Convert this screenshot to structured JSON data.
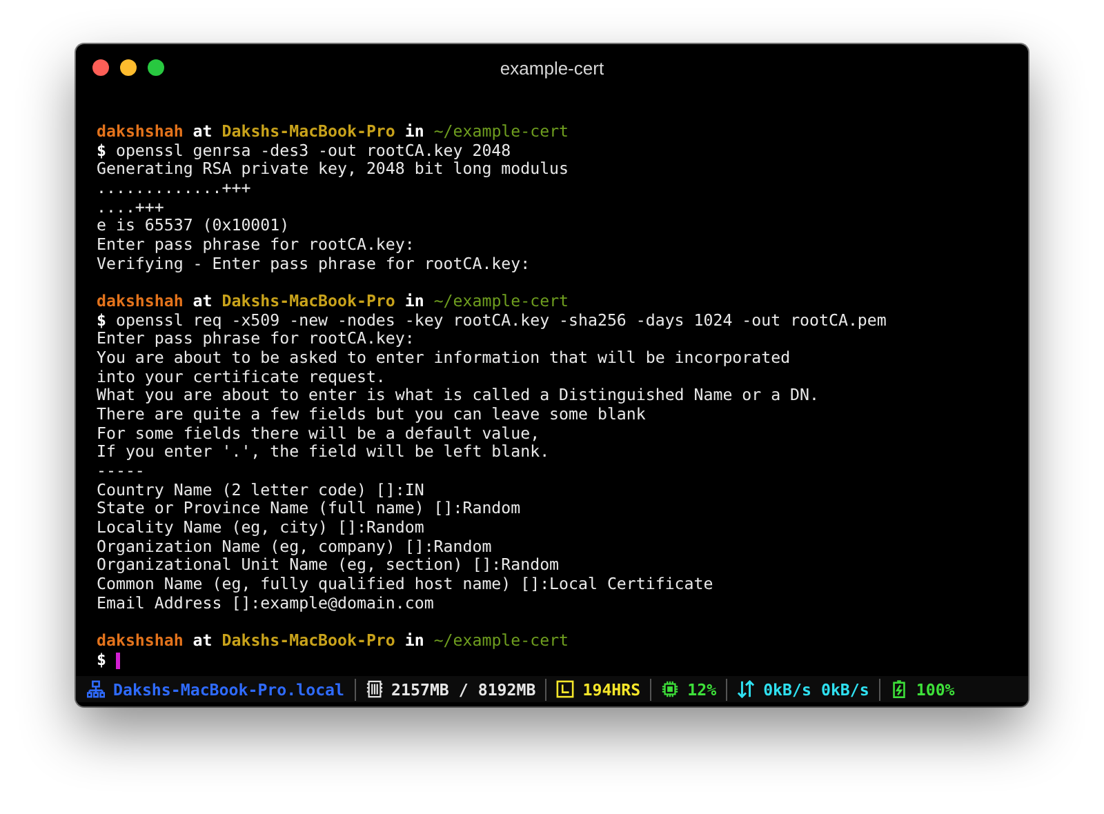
{
  "window": {
    "title": "example-cert"
  },
  "lines": [
    {
      "kind": "prompt",
      "user": "dakshshah",
      "at": "at",
      "host": "Dakshs-MacBook-Pro",
      "in": "in",
      "path": "~/example-cert"
    },
    {
      "kind": "command",
      "prompt": "$",
      "text": "openssl genrsa -des3 -out rootCA.key 2048"
    },
    {
      "kind": "output",
      "text": "Generating RSA private key, 2048 bit long modulus"
    },
    {
      "kind": "output",
      "text": ".............+++"
    },
    {
      "kind": "output",
      "text": "....+++"
    },
    {
      "kind": "output",
      "text": "e is 65537 (0x10001)"
    },
    {
      "kind": "output",
      "text": "Enter pass phrase for rootCA.key:"
    },
    {
      "kind": "output",
      "text": "Verifying - Enter pass phrase for rootCA.key:"
    },
    {
      "kind": "blank"
    },
    {
      "kind": "prompt",
      "user": "dakshshah",
      "at": "at",
      "host": "Dakshs-MacBook-Pro",
      "in": "in",
      "path": "~/example-cert"
    },
    {
      "kind": "command",
      "prompt": "$",
      "text": "openssl req -x509 -new -nodes -key rootCA.key -sha256 -days 1024 -out rootCA.pem"
    },
    {
      "kind": "output",
      "text": "Enter pass phrase for rootCA.key:"
    },
    {
      "kind": "output",
      "text": "You are about to be asked to enter information that will be incorporated"
    },
    {
      "kind": "output",
      "text": "into your certificate request."
    },
    {
      "kind": "output",
      "text": "What you are about to enter is what is called a Distinguished Name or a DN."
    },
    {
      "kind": "output",
      "text": "There are quite a few fields but you can leave some blank"
    },
    {
      "kind": "output",
      "text": "For some fields there will be a default value,"
    },
    {
      "kind": "output",
      "text": "If you enter '.', the field will be left blank."
    },
    {
      "kind": "output",
      "text": "-----"
    },
    {
      "kind": "output",
      "text": "Country Name (2 letter code) []:IN"
    },
    {
      "kind": "output",
      "text": "State or Province Name (full name) []:Random"
    },
    {
      "kind": "output",
      "text": "Locality Name (eg, city) []:Random"
    },
    {
      "kind": "output",
      "text": "Organization Name (eg, company) []:Random"
    },
    {
      "kind": "output",
      "text": "Organizational Unit Name (eg, section) []:Random"
    },
    {
      "kind": "output",
      "text": "Common Name (eg, fully qualified host name) []:Local Certificate"
    },
    {
      "kind": "output",
      "text": "Email Address []:example@domain.com"
    },
    {
      "kind": "blank"
    },
    {
      "kind": "prompt",
      "user": "dakshshah",
      "at": "at",
      "host": "Dakshs-MacBook-Pro",
      "in": "in",
      "path": "~/example-cert"
    },
    {
      "kind": "cursor",
      "prompt": "$"
    }
  ],
  "status_bar": [
    {
      "kind": "host",
      "text": "Dakshs-MacBook-Pro.local",
      "color": "#2f6bff"
    },
    {
      "kind": "memory",
      "text": "2157MB / 8192MB",
      "color": "#e6e6e6"
    },
    {
      "kind": "uptime",
      "text": "194HRS",
      "color": "#f5e62a"
    },
    {
      "kind": "cpu",
      "text": "12%",
      "color": "#3ee03a"
    },
    {
      "kind": "network",
      "text": "0kB/s 0kB/s",
      "color": "#2fe0f0"
    },
    {
      "kind": "battery",
      "text": "100%",
      "color": "#3ee03a"
    }
  ]
}
